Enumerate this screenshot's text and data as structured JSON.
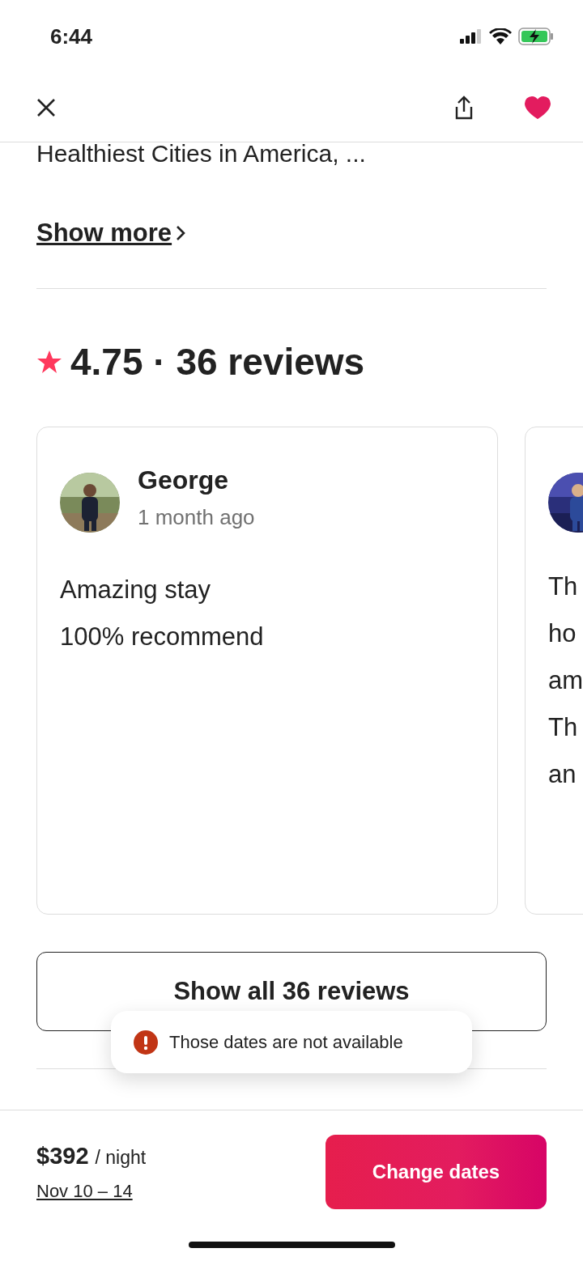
{
  "status_bar": {
    "time": "6:44"
  },
  "header": {
    "favorited": true
  },
  "description": {
    "text": "Healthiest Cities in America, ...",
    "link": "Show more"
  },
  "rating": {
    "title": "4.75 · 36 reviews"
  },
  "reviews": [
    {
      "name": "George",
      "time": "1 month ago",
      "lines": [
        "Amazing stay",
        "100% recommend"
      ]
    },
    {
      "lines": [
        "Th",
        "ho",
        "am",
        "Th",
        "an"
      ]
    }
  ],
  "show_all_button": "Show all 36 reviews",
  "toast": {
    "message": "Those dates are not available"
  },
  "footer": {
    "price": "$392",
    "unit": "/ night",
    "dates": "Nov 10 – 14",
    "button": "Change dates"
  }
}
